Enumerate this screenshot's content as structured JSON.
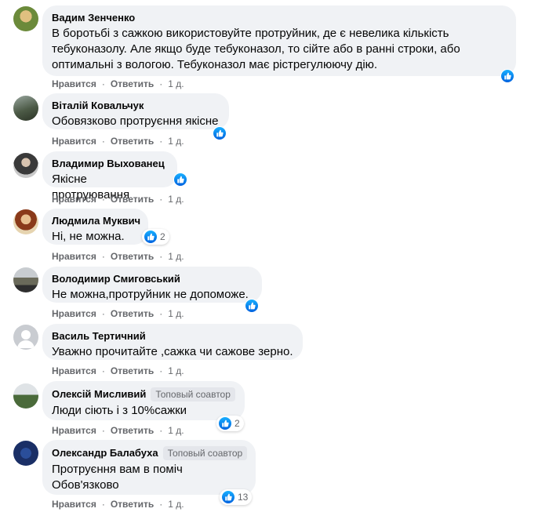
{
  "labels": {
    "like": "Нравится",
    "reply": "Ответить"
  },
  "comments": [
    {
      "name": "Вадим Зенченко",
      "lines": [
        "В боротьбі з сажкою використовуйте протруйник, де є невелика кількість",
        "тебуконазолу. Але якщо буде тебуконазол, то сійте або в ранні строки, або",
        "оптимальні з вологою. Тебуконазол має рістрегулюючу дію."
      ],
      "time": "1 д.",
      "reactions": ""
    },
    {
      "name": "Віталій Ковальчук",
      "lines": [
        "Обовязково протруєння якісне"
      ],
      "time": "1 д.",
      "reactions": ""
    },
    {
      "name": "Владимир Выхованец",
      "lines": [
        "Якісне протруювання"
      ],
      "time": "1 д.",
      "reactions": ""
    },
    {
      "name": "Людмила Муквич",
      "lines": [
        "Ні, не можна."
      ],
      "time": "1 д.",
      "reactions": "2"
    },
    {
      "name": "Володимир Смиговський",
      "lines": [
        "Не можна,протруйник не допоможе."
      ],
      "time": "1 д.",
      "reactions": ""
    },
    {
      "name": "Василь Тертичний",
      "lines": [
        "Уважно прочитайте ,сажка чи сажове зерно."
      ],
      "time": "1 д.",
      "reactions": ""
    },
    {
      "name": "Олексій Мисливий",
      "badge": "Топовый соавтор",
      "lines": [
        "Люди сіють і з 10%сажки"
      ],
      "time": "1 д.",
      "reactions": "2"
    },
    {
      "name": "Олександр Балабуха",
      "badge": "Топовый соавтор",
      "lines": [
        "Протруєння вам в поміч",
        "Обов'язково"
      ],
      "time": "1 д.",
      "reactions": "13"
    }
  ],
  "colors": {
    "like_blue": "#0866ff",
    "bubble": "#f0f2f5",
    "meta": "#65676b"
  }
}
